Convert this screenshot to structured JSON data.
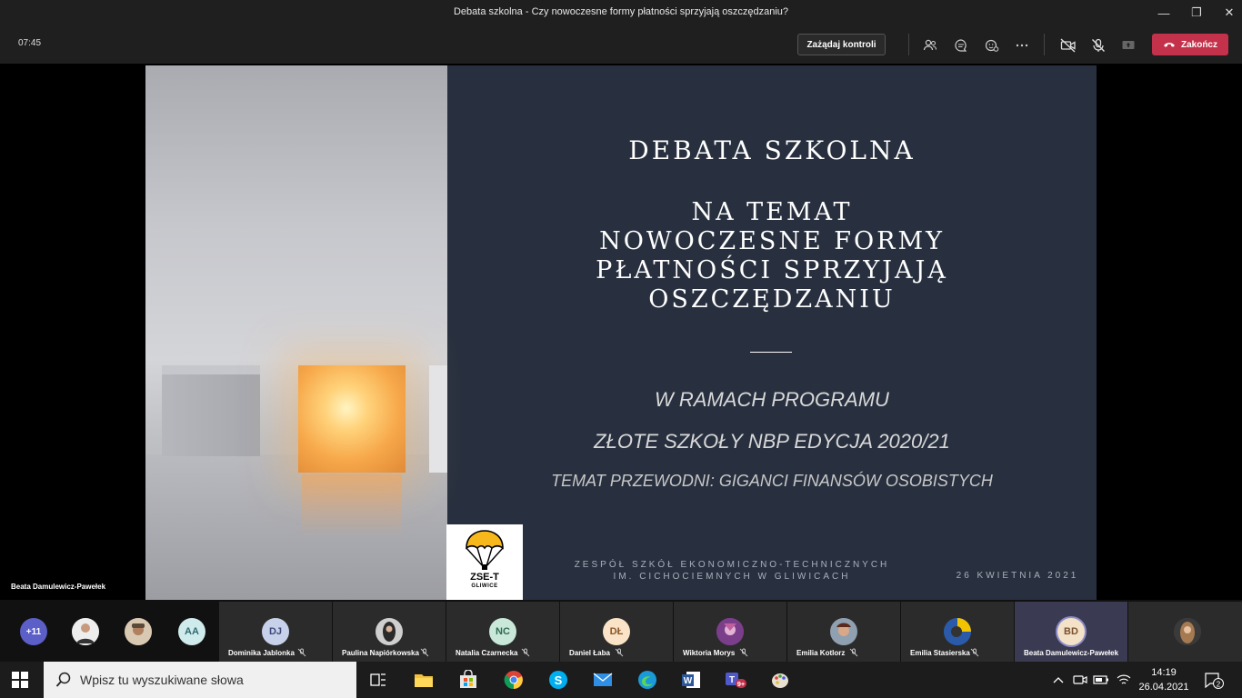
{
  "window": {
    "title": "Debata szkolna - Czy nowoczesne formy płatności sprzyjają oszczędzaniu?",
    "minimize": "—",
    "maximize": "❐",
    "close": "✕"
  },
  "toolbar": {
    "timer": "07:45",
    "request_control_label": "Zażądaj kontroli",
    "end_label": "Zakończ"
  },
  "slide": {
    "title": "DEBATA SZKOLNA",
    "topic_lines": [
      "NA TEMAT",
      "NOWOCZESNE FORMY",
      "PŁATNOŚCI SPRZYJAJĄ",
      "OSZCZĘDZANIU"
    ],
    "program_line1": "W RAMACH PROGRAMU",
    "program_line2": "ZŁOTE SZKOŁY NBP EDYCJA 2020/21",
    "theme_line": "TEMAT PRZEWODNI: GIGANCI FINANSÓW OSOBISTYCH",
    "school_line1": "ZESPÓŁ SZKÓŁ EKONOMICZNO-TECHNICZNYCH",
    "school_line2": "IM. CICHOCIEMNYCH W GLIWICACH",
    "date": "26 KWIETNIA 2021",
    "logo_text": "ZSE-T",
    "logo_sub": "GLIWICE"
  },
  "presenter_name": "Beata Damulewicz-Pawełek",
  "participants": {
    "overflow_count": "+11",
    "initials_aa": "AA",
    "tiles": [
      {
        "initials": "DJ",
        "name": "Dominika Jablonka",
        "bg": "#c7d2ea",
        "fg": "#3d4a7a"
      },
      {
        "initials": "",
        "name": "Paulina Napiórkowska",
        "bg": "#444444",
        "fg": "#ffffff"
      },
      {
        "initials": "NC",
        "name": "Natalia Czarnecka",
        "bg": "#c9e8d9",
        "fg": "#2f6a55"
      },
      {
        "initials": "DŁ",
        "name": "Daniel Łaba",
        "bg": "#fbe3c7",
        "fg": "#8a5a2a"
      },
      {
        "initials": "",
        "name": "Wiktoria Morys",
        "bg": "#7a3e8a",
        "fg": "#ffffff"
      },
      {
        "initials": "",
        "name": "Emilia Kotlorz",
        "bg": "#6a4a3a",
        "fg": "#ffffff"
      },
      {
        "initials": "",
        "name": "Emilia Stasierska",
        "bg": "#2a5aa8",
        "fg": "#ffffff"
      },
      {
        "initials": "BD",
        "name": "Beata Damulewicz-Pawełek",
        "bg": "#f3e1c8",
        "fg": "#7a5230"
      }
    ]
  },
  "taskbar": {
    "search_placeholder": "Wpisz tu wyszukiwane słowa",
    "time": "14:19",
    "date": "26.04.2021",
    "notifications": "2",
    "teams_badge": "9+"
  }
}
